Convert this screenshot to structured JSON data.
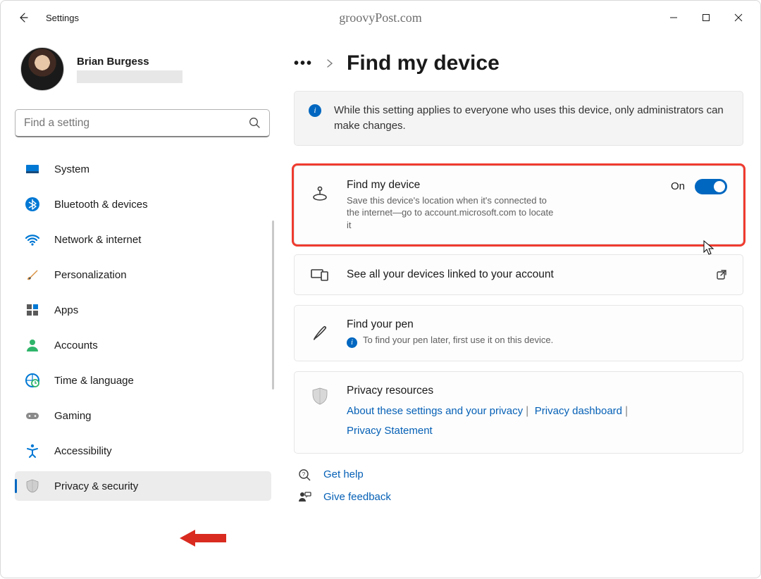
{
  "window": {
    "app_title": "Settings",
    "watermark": "groovyPost.com"
  },
  "profile": {
    "name": "Brian Burgess"
  },
  "search": {
    "placeholder": "Find a setting"
  },
  "sidebar": {
    "items": [
      {
        "label": "System"
      },
      {
        "label": "Bluetooth & devices"
      },
      {
        "label": "Network & internet"
      },
      {
        "label": "Personalization"
      },
      {
        "label": "Apps"
      },
      {
        "label": "Accounts"
      },
      {
        "label": "Time & language"
      },
      {
        "label": "Gaming"
      },
      {
        "label": "Accessibility"
      },
      {
        "label": "Privacy & security"
      }
    ],
    "selected_index": 9
  },
  "page": {
    "title": "Find my device",
    "info": "While this setting applies to everyone who uses this device, only administrators can make changes.",
    "cards": {
      "find_device": {
        "title": "Find my device",
        "sub": "Save this device's location when it's connected to the internet—go to account.microsoft.com to locate it",
        "state_label": "On"
      },
      "see_devices": {
        "title": "See all your devices linked to your account"
      },
      "find_pen": {
        "title": "Find your pen",
        "sub": "To find your pen later, first use it on this device."
      },
      "privacy": {
        "title": "Privacy resources",
        "links": [
          "About these settings and your privacy",
          "Privacy dashboard",
          "Privacy Statement"
        ]
      }
    },
    "footer": {
      "help": "Get help",
      "feedback": "Give feedback"
    }
  }
}
